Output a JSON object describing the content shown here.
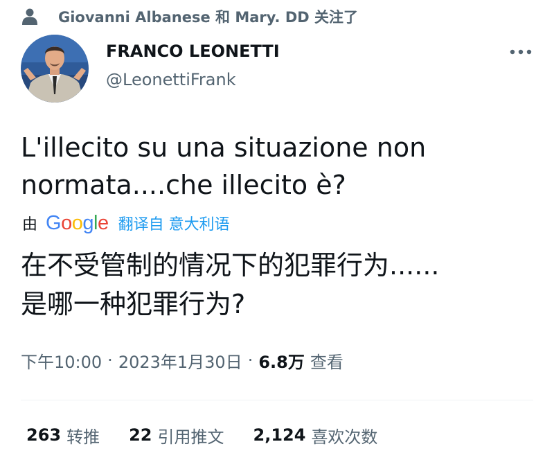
{
  "social_context": {
    "icon": "person-icon",
    "text": "Giovanni Albanese 和 Mary. DD 关注了"
  },
  "author": {
    "display_name": "FRANCO LEONETTI",
    "handle": "@LeonettiFrank"
  },
  "more_icon": "more-horizontal-icon",
  "tweet": {
    "lines": [
      "L'illecito su una situazione non",
      "normata....che illecito è?"
    ]
  },
  "translation": {
    "by_label": "由",
    "provider": "Google",
    "link_text": "翻译自 意大利语",
    "lines": [
      "在不受管制的情况下的犯罪行为......",
      "是哪一种犯罪行为?"
    ]
  },
  "meta": {
    "time": "下午10:00",
    "separator": "·",
    "date": "2023年1月30日",
    "views_count": "6.8万",
    "views_label": "查看"
  },
  "stats": {
    "retweets_count": "263",
    "retweets_label": "转推",
    "quotes_count": "22",
    "quotes_label": "引用推文",
    "likes_count": "2,124",
    "likes_label": "喜欢次数"
  },
  "colors": {
    "primary_text": "#0f1419",
    "secondary_text": "#536471",
    "link": "#1d9bf0",
    "divider": "#eff3f4",
    "google_blue": "#4285f4",
    "google_red": "#ea4335",
    "google_yellow": "#fbbc05",
    "google_green": "#34a853"
  }
}
